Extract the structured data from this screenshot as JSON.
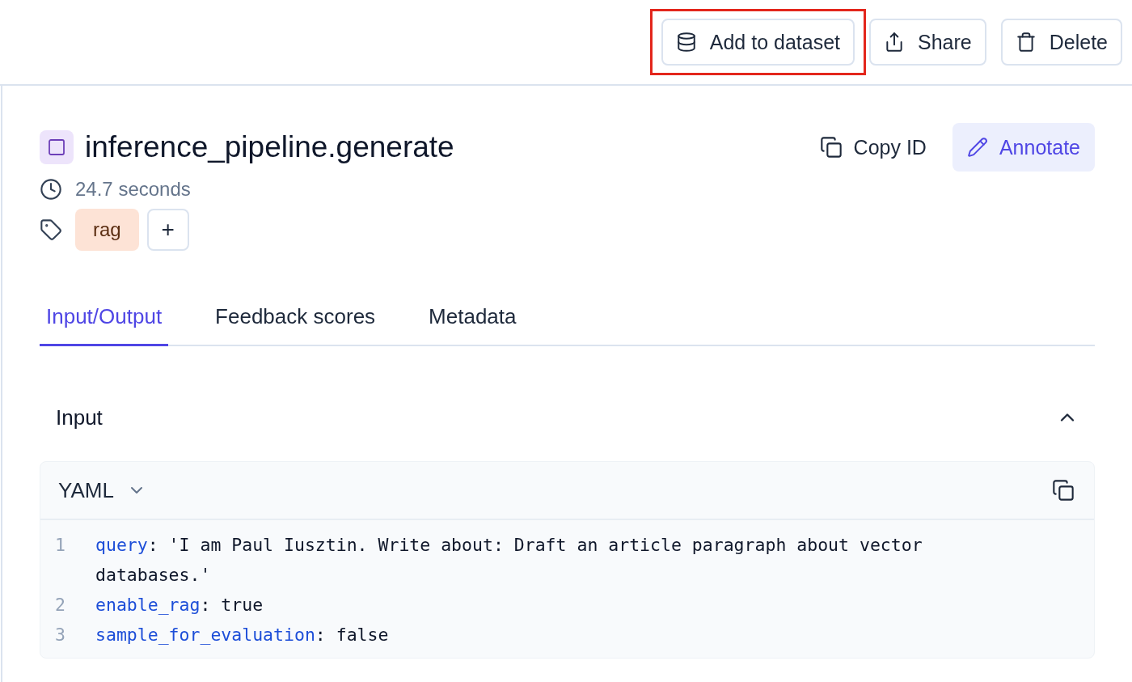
{
  "toolbar": {
    "actions": [
      {
        "kind": "dataset",
        "label": "Add to dataset",
        "highlighted": true
      },
      {
        "kind": "share",
        "label": "Share",
        "highlighted": false
      },
      {
        "kind": "delete",
        "label": "Delete",
        "highlighted": false
      }
    ]
  },
  "span": {
    "title": "inference_pipeline.generate",
    "copy_label": "Copy ID",
    "annotate_label": "Annotate",
    "duration": "24.7 seconds",
    "tags": [
      {
        "label": "rag",
        "color": "#fde3d6"
      }
    ],
    "add_tag": "+"
  },
  "tabs": [
    {
      "label": "Input/Output",
      "selected": true
    },
    {
      "label": "Feedback scores",
      "selected": false
    },
    {
      "label": "Metadata",
      "selected": false
    }
  ],
  "input": {
    "title": "Input",
    "expanded": true,
    "format": "YAML",
    "lines": [
      {
        "number": "1",
        "key": "query",
        "value": ": 'I am Paul Iusztin. Write about: Draft an article paragraph about vector databases.'"
      },
      {
        "number": "2",
        "key": "enable_rag",
        "value": ": true"
      },
      {
        "number": "3",
        "key": "sample_for_evaluation",
        "value": ": false"
      }
    ]
  }
}
